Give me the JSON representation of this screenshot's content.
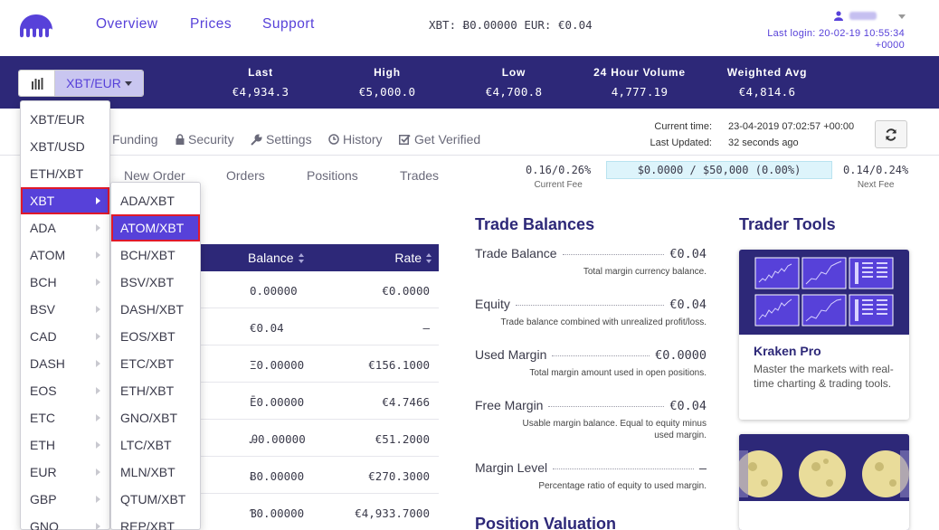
{
  "header": {
    "nav": [
      "Overview",
      "Prices",
      "Support"
    ],
    "balances_text": "XBT: Ƀ0.00000  EUR: €0.04",
    "last_login_label": "Last login: 20-02-19 10:55:34",
    "last_login_tz": "+0000"
  },
  "ticker": {
    "pair_label": "XBT/EUR",
    "stats": [
      {
        "label": "Last",
        "value": "€4,934.3"
      },
      {
        "label": "High",
        "value": "€5,000.0"
      },
      {
        "label": "Low",
        "value": "€4,700.8"
      },
      {
        "label": "24 Hour Volume",
        "value": "4,777.19"
      },
      {
        "label": "Weighted Avg",
        "value": "€4,814.6"
      }
    ]
  },
  "subtabs": [
    "Funding",
    "Security",
    "Settings",
    "History",
    "Get Verified"
  ],
  "time_info": {
    "current_time_label": "Current time:",
    "current_time_value": "23-04-2019 07:02:57 +00:00",
    "updated_label": "Last Updated:",
    "updated_value": "32 seconds ago"
  },
  "order_tabs": [
    "New Order",
    "Orders",
    "Positions",
    "Trades"
  ],
  "fees": {
    "current_value": "0.16/0.26%",
    "current_label": "Current Fee",
    "progress_text": "$0.0000 / $50,000 (0.00%)",
    "next_value": "0.14/0.24%",
    "next_label": "Next Fee"
  },
  "balance_table": {
    "headers": [
      "Balance",
      "Rate"
    ],
    "rows": [
      {
        "balance": "0.00000",
        "rate": "€0.0000"
      },
      {
        "balance": "€0.04",
        "rate": "—"
      },
      {
        "balance": "Ξ0.00000",
        "rate": "€156.1000"
      },
      {
        "balance": "Ē0.00000",
        "rate": "€4.7466"
      },
      {
        "balance": "Ꭿ0.00000",
        "rate": "€51.2000"
      },
      {
        "balance": "Ƀ0.00000",
        "rate": "€270.3000"
      },
      {
        "balance": "Ɓ0.00000",
        "rate": "€4,933.7000"
      }
    ]
  },
  "trade_balances": {
    "title": "Trade Balances",
    "items": [
      {
        "label": "Trade Balance",
        "value": "€0.04",
        "desc": "Total margin currency balance."
      },
      {
        "label": "Equity",
        "value": "€0.04",
        "desc": "Trade balance combined with unrealized profit/loss."
      },
      {
        "label": "Used Margin",
        "value": "€0.0000",
        "desc": "Total margin amount used in open positions."
      },
      {
        "label": "Free Margin",
        "value": "€0.04",
        "desc": "Usable margin balance. Equal to equity minus used margin."
      },
      {
        "label": "Margin Level",
        "value": "—",
        "desc": "Percentage ratio of equity to used margin."
      }
    ],
    "next_section": "Position Valuation"
  },
  "trader_tools": {
    "title": "Trader Tools",
    "card": {
      "title": "Kraken Pro",
      "desc": "Master the markets with real-time charting & trading tools."
    }
  },
  "dropdown": {
    "base": [
      "XBT/EUR",
      "XBT/USD",
      "ETH/XBT",
      "XBT",
      "ADA",
      "ATOM",
      "BCH",
      "BSV",
      "CAD",
      "DASH",
      "EOS",
      "ETC",
      "ETH",
      "EUR",
      "GBP",
      "GNO"
    ],
    "submenu": [
      "ADA/XBT",
      "ATOM/XBT",
      "BCH/XBT",
      "BSV/XBT",
      "DASH/XBT",
      "EOS/XBT",
      "ETC/XBT",
      "ETH/XBT",
      "GNO/XBT",
      "LTC/XBT",
      "MLN/XBT",
      "QTUM/XBT",
      "REP/XBT"
    ]
  },
  "colors": {
    "brand": "#5741d9",
    "navy": "#2d2878",
    "highlight": "#e0192a"
  }
}
